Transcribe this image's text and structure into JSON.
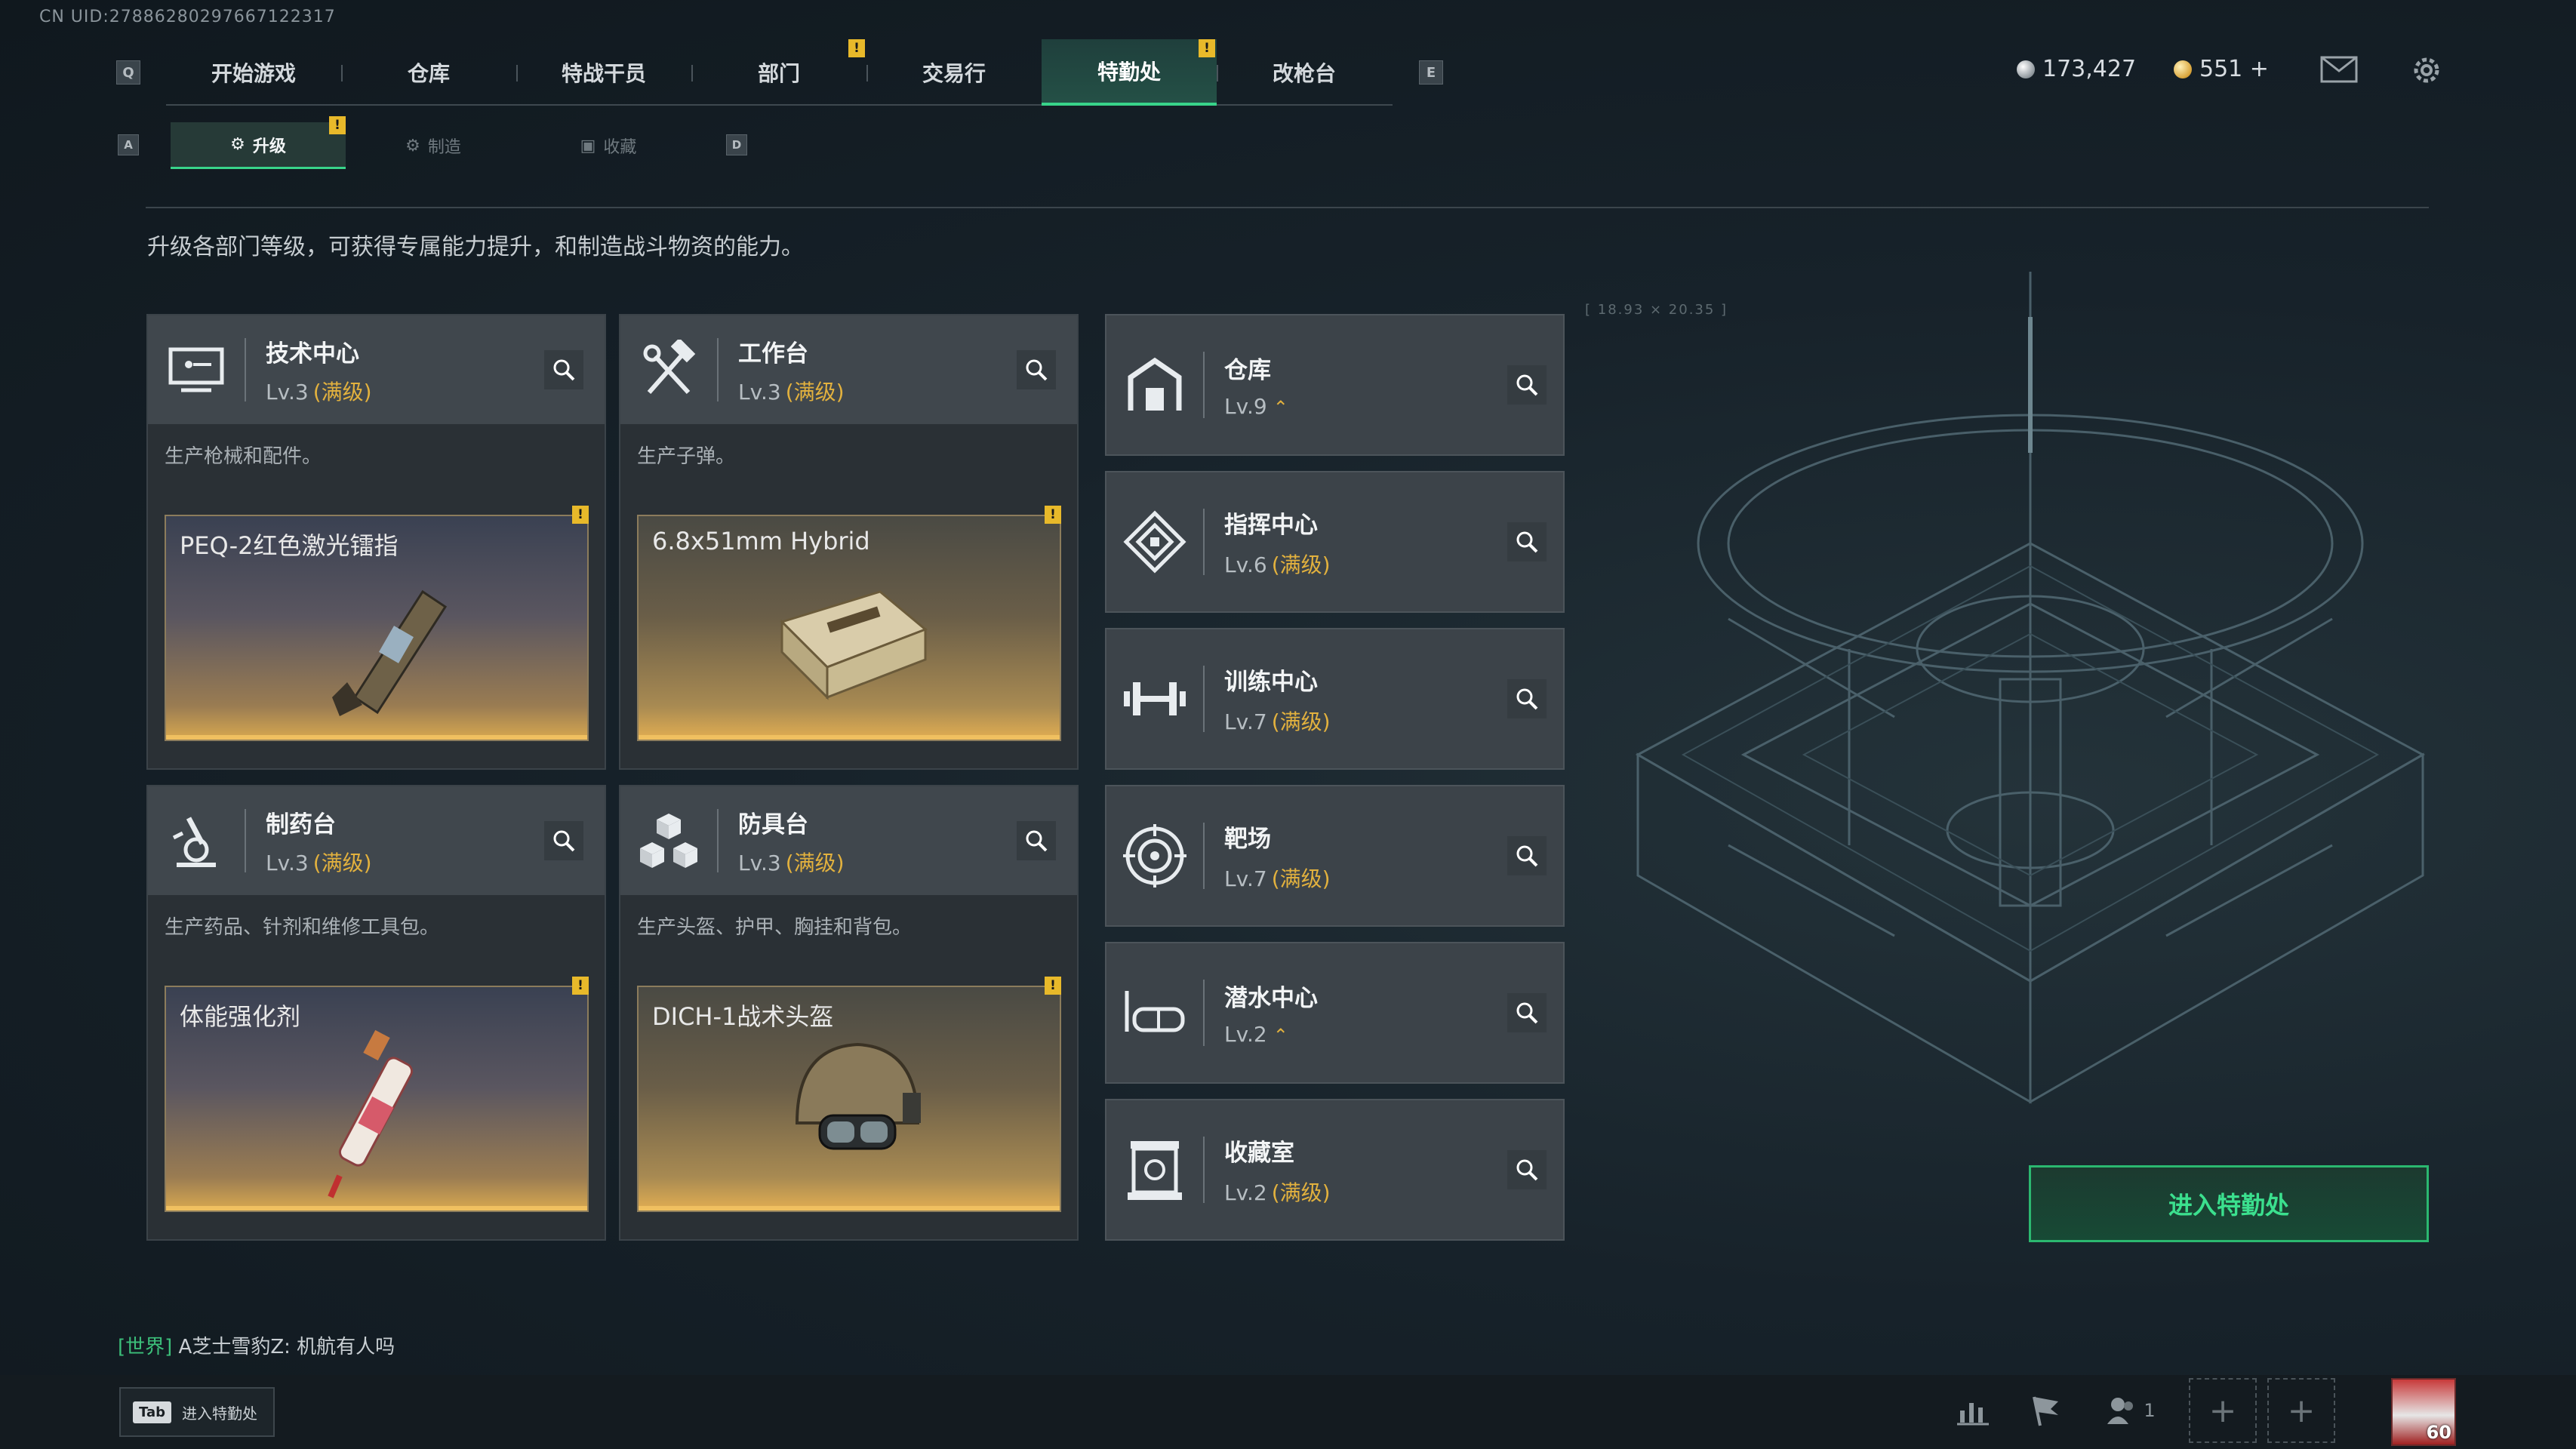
{
  "uid": "CN UID:27886280297667122317",
  "key_hints": {
    "prev_tab": "Q",
    "next_tab": "E",
    "prev_sub": "A",
    "next_sub": "D"
  },
  "top_nav": {
    "tabs": [
      {
        "label": "开始游戏"
      },
      {
        "label": "仓库"
      },
      {
        "label": "特战干员"
      },
      {
        "label": "部门",
        "badge": "!"
      },
      {
        "label": "交易行"
      },
      {
        "label": "特勤处",
        "badge": "!",
        "active": true
      },
      {
        "label": "改枪台"
      }
    ]
  },
  "currency": {
    "silver": "173,427",
    "gold": "551 +"
  },
  "sub_nav": {
    "tabs": [
      {
        "label": "升级",
        "active": true,
        "badge": "!"
      },
      {
        "label": "制造"
      },
      {
        "label": "收藏"
      }
    ]
  },
  "description": "升级各部门等级，可获得专属能力提升，和制造战斗物资的能力。",
  "dept_cards": [
    {
      "title": "技术中心",
      "level": "Lv.3",
      "maxed": "(满级)",
      "subdesc": "生产枪械和配件。",
      "product": "PEQ-2红色激光镭指",
      "badge": "!"
    },
    {
      "title": "工作台",
      "level": "Lv.3",
      "maxed": "(满级)",
      "subdesc": "生产子弹。",
      "product": "6.8x51mm Hybrid",
      "badge": "!"
    },
    {
      "title": "制药台",
      "level": "Lv.3",
      "maxed": "(满级)",
      "subdesc": "生产药品、针剂和维修工具包。",
      "product": "体能强化剂",
      "badge": "!"
    },
    {
      "title": "防具台",
      "level": "Lv.3",
      "maxed": "(满级)",
      "subdesc": "生产头盔、护甲、胸挂和背包。",
      "product": "DICH-1战术头盔",
      "badge": "!"
    }
  ],
  "facilities": [
    {
      "title": "仓库",
      "level": "Lv.9",
      "maxed": "",
      "upgradable": "⌃"
    },
    {
      "title": "指挥中心",
      "level": "Lv.6",
      "maxed": "(满级)",
      "upgradable": ""
    },
    {
      "title": "训练中心",
      "level": "Lv.7",
      "maxed": "(满级)",
      "upgradable": ""
    },
    {
      "title": "靶场",
      "level": "Lv.7",
      "maxed": "(满级)",
      "upgradable": ""
    },
    {
      "title": "潜水中心",
      "level": "Lv.2",
      "maxed": "",
      "upgradable": "⌃"
    },
    {
      "title": "收藏室",
      "level": "Lv.2",
      "maxed": "(满级)",
      "upgradable": ""
    }
  ],
  "scene_label": "[ 18.93 × 20.35 ]",
  "enter_button": "进入特勤处",
  "chat": {
    "channel": "[世界]",
    "message": " A芝士雪豹Z: 机航有人吗"
  },
  "tab_hint": {
    "key": "Tab",
    "label": "进入特勤处"
  },
  "bottom": {
    "friends_count": "1",
    "player_level": "60"
  },
  "colors": {
    "accent": "#38d48a",
    "maxed": "#e2b13e",
    "badge": "#e8b92a"
  }
}
